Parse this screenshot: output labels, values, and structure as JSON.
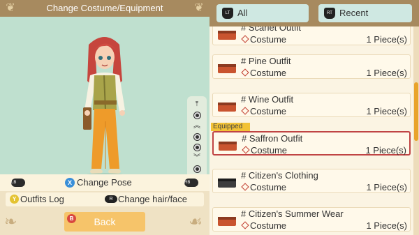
{
  "header": {
    "title": "Change Costume/Equipment"
  },
  "controls": {
    "lb": "LB",
    "rb": "RB",
    "x_button": "X",
    "change_pose": "Change Pose",
    "y_button": "Y",
    "outfits_log": "Outfits Log",
    "stick_icon": "R",
    "change_hair": "Change hair/face",
    "b_button": "B",
    "back": "Back"
  },
  "tabs": [
    {
      "trigger": "LT",
      "label": "All"
    },
    {
      "trigger": "RT",
      "label": "Recent"
    }
  ],
  "equipped_label": "Equipped",
  "items": [
    {
      "name": "# Scarlet Outfit",
      "category": "Costume",
      "qty": "1 Piece(s)",
      "icon": "red-box-icon",
      "color": "#c9542f"
    },
    {
      "name": "# Pine Outfit",
      "category": "Costume",
      "qty": "1 Piece(s)",
      "icon": "red-box-icon",
      "color": "#c9542f"
    },
    {
      "name": "# Wine Outfit",
      "category": "Costume",
      "qty": "1 Piece(s)",
      "icon": "red-box-icon",
      "color": "#c9542f"
    },
    {
      "name": "# Saffron Outfit",
      "category": "Costume",
      "qty": "1 Piece(s)",
      "icon": "red-box-icon",
      "color": "#c9542f",
      "equipped": true
    },
    {
      "name": "# Citizen's Clothing",
      "category": "Costume",
      "qty": "1 Piece(s)",
      "icon": "black-box-icon",
      "color": "#3d3d3d"
    },
    {
      "name": "# Citizen's Summer Wear",
      "category": "Costume",
      "qty": "1 Piece(s)",
      "icon": "red-box-icon",
      "color": "#c9542f"
    }
  ],
  "colors": {
    "header": "#a78a5f",
    "preview_bg": "#bfe0cf",
    "accent": "#e9a32b",
    "equipped_border": "#c04444"
  }
}
